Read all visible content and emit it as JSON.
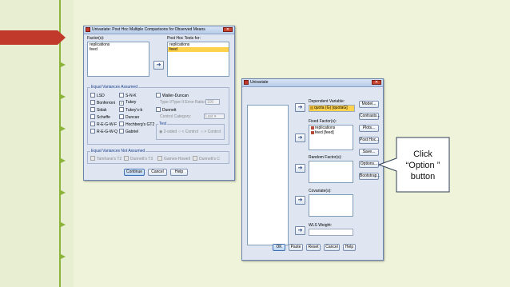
{
  "posthoc_dialog": {
    "title": "Univariate: Post Hoc Multiple Comparisons for Observed Means",
    "factors_label": "Factor(s):",
    "factors": [
      "replications",
      "feed"
    ],
    "posthoc_label": "Post Hoc Tests for:",
    "posthoc_tests_for": [
      "replications",
      "feed"
    ],
    "equal_variances_assumed_label": "Equal Variances Assumed",
    "checks": {
      "lsd": "LSD",
      "snk": "S-N-K",
      "waller_duncan": "Waller-Duncan",
      "bonferroni": "Bonferroni",
      "tukey": "Tukey",
      "type_ratio": "Type I/Type II Error Ratio:",
      "type_ratio_value": "100",
      "sidak": "Sidak",
      "tukeys_b": "Tukey's-b",
      "dunnett": "Dunnett",
      "scheffe": "Scheffe",
      "duncan": "Duncan",
      "control_category": "Control Category:",
      "control_value": "Last",
      "regwf": "R-E-G-W-F",
      "hochberg": "Hochberg's GT2",
      "test_label": "Test",
      "regwq": "R-E-G-W-Q",
      "gabriel": "Gabriel",
      "two_sided": "2-sided",
      "less_control": "< Control",
      "greater_control": "> Control"
    },
    "not_assumed_label": "Equal Variances Not Assumed",
    "not_assumed": {
      "tamhane": "Tamhane's T2",
      "dunnett_t3": "Dunnett's T3",
      "games_howell": "Games-Howell",
      "dunnett_c": "Dunnett's C"
    },
    "buttons": {
      "continue": "Continue",
      "cancel": "Cancel",
      "help": "Help"
    }
  },
  "univariate_dialog": {
    "title": "Univariate",
    "dependent_label": "Dependent Variable:",
    "dependent_value": "quota (G) [quotaG]",
    "fixed_label": "Fixed Factor(s):",
    "fixed_factors": [
      "replications",
      "feed [feed]"
    ],
    "random_label": "Random Factor(s):",
    "covariate_label": "Covariate(s):",
    "wls_label": "WLS Weight:",
    "side_buttons": [
      "Model...",
      "Contrasts...",
      "Plots...",
      "Post Hoc...",
      "Save...",
      "Options...",
      "Bootstrap..."
    ],
    "bottom_buttons": {
      "ok": "OK",
      "paste": "Paste",
      "reset": "Reset",
      "cancel": "Cancel",
      "help": "Help"
    }
  },
  "callout": {
    "text": "Click “Option ” button"
  },
  "colors": {
    "accent_green": "#8cb33a",
    "banner_red": "#c0392b",
    "highlight": "#ffd24d"
  }
}
